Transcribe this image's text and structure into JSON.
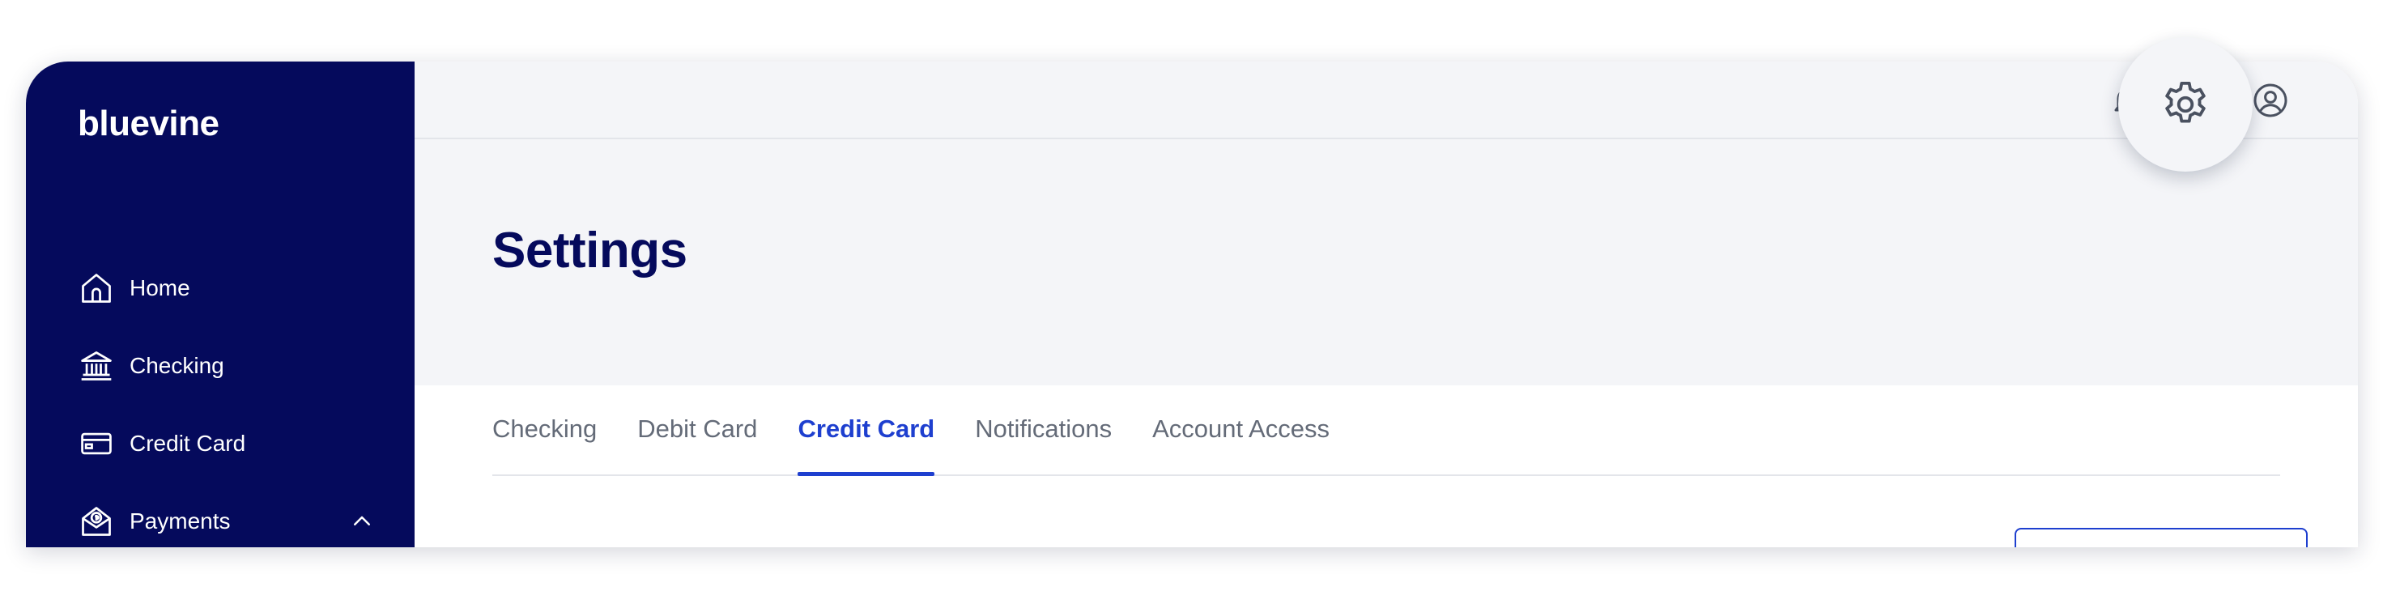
{
  "brand": {
    "logo_text": "bluevine"
  },
  "sidebar": {
    "items": [
      {
        "label": "Home",
        "icon": "home-icon"
      },
      {
        "label": "Checking",
        "icon": "bank-icon"
      },
      {
        "label": "Credit Card",
        "icon": "credit-card-icon"
      },
      {
        "label": "Payments",
        "icon": "payments-icon",
        "expanded": true
      }
    ]
  },
  "topbar": {
    "icons": [
      "bell-icon",
      "gear-icon",
      "user-icon"
    ]
  },
  "page": {
    "title": "Settings"
  },
  "tabs": {
    "items": [
      {
        "label": "Checking"
      },
      {
        "label": "Debit Card"
      },
      {
        "label": "Credit Card",
        "active": true
      },
      {
        "label": "Notifications"
      },
      {
        "label": "Account Access"
      }
    ]
  },
  "colors": {
    "sidebar_bg": "#050a5c",
    "accent": "#1e3fcf",
    "muted_text": "#646b78",
    "hero_bg": "#f4f5f8"
  }
}
